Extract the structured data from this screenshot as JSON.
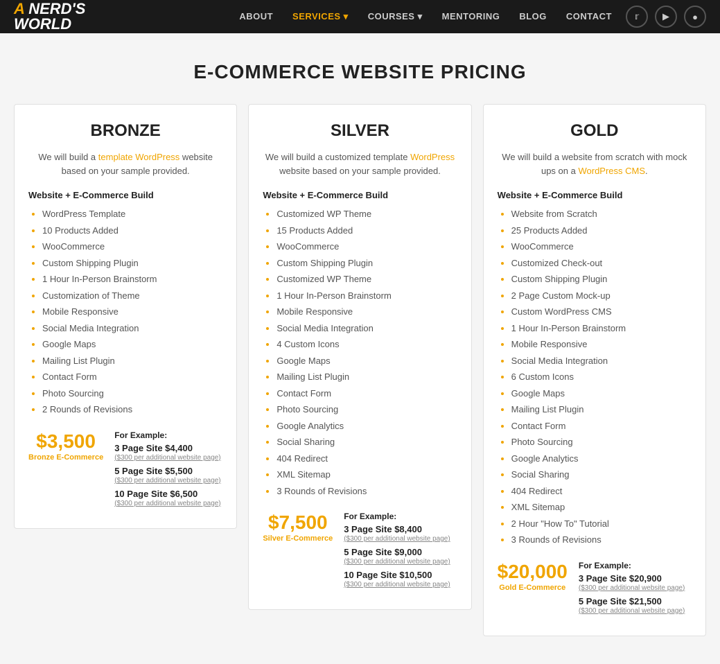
{
  "nav": {
    "logo_line1": "A NERD'S",
    "logo_line2": "WORLD",
    "links": [
      {
        "label": "ABOUT",
        "active": false
      },
      {
        "label": "SERVICES",
        "active": true,
        "has_dropdown": true
      },
      {
        "label": "COURSES",
        "active": false,
        "has_dropdown": true
      },
      {
        "label": "MENTORING",
        "active": false
      },
      {
        "label": "BLOG",
        "active": false
      },
      {
        "label": "CONTACT",
        "active": false
      }
    ],
    "social_icons": [
      "twitter",
      "youtube",
      "instagram"
    ]
  },
  "page": {
    "title": "E-COMMERCE WEBSITE PRICING"
  },
  "plans": [
    {
      "id": "bronze",
      "title": "BRONZE",
      "desc_parts": [
        "We will build a ",
        "template WordPress",
        " website based on your sample provided."
      ],
      "desc_link": "template WordPress",
      "section_header": "Website + E-Commerce Build",
      "features": [
        "WordPress Template",
        "10 Products Added",
        "WooCommerce",
        "Custom Shipping Plugin",
        "1 Hour In-Person Brainstorm",
        "Customization of Theme",
        "Mobile Responsive",
        "Social Media Integration",
        "Google Maps",
        "Mailing List Plugin",
        "Contact Form",
        "Photo Sourcing",
        "2 Rounds of Revisions"
      ],
      "price_amount": "$3,500",
      "price_label": "Bronze E-Commerce",
      "for_example": "For Example:",
      "price_rows": [
        {
          "label": "3 Page Site $4,400",
          "sub": "($300 per additional website page)"
        },
        {
          "label": "5 Page Site $5,500",
          "sub": "($300 per additional website page)"
        },
        {
          "label": "10 Page Site $6,500",
          "sub": "($300 per additional website page)"
        }
      ]
    },
    {
      "id": "silver",
      "title": "SILVER",
      "desc_parts": [
        "We will build a customized template ",
        "WordPress",
        " website based on your sample provided."
      ],
      "desc_link": "WordPress",
      "section_header": "Website + E-Commerce Build",
      "features": [
        "Customized WP Theme",
        "15 Products Added",
        "WooCommerce",
        "Custom Shipping Plugin",
        "Customized WP Theme",
        "1 Hour In-Person Brainstorm",
        "Mobile Responsive",
        "Social Media Integration",
        "4 Custom Icons",
        "Google Maps",
        "Mailing List Plugin",
        "Contact Form",
        "Photo Sourcing",
        "Google Analytics",
        "Social Sharing",
        "404 Redirect",
        "XML Sitemap",
        "3 Rounds of Revisions"
      ],
      "price_amount": "$7,500",
      "price_label": "Silver E-Commerce",
      "for_example": "For Example:",
      "price_rows": [
        {
          "label": "3 Page Site $8,400",
          "sub": "($300 per additional website page)"
        },
        {
          "label": "5 Page Site $9,000",
          "sub": "($300 per additional website page)"
        },
        {
          "label": "10 Page Site $10,500",
          "sub": "($300 per additional website page)"
        }
      ]
    },
    {
      "id": "gold",
      "title": "GOLD",
      "desc_parts": [
        "We will build a website from scratch with mock ups on a ",
        "WordPress CMS",
        "."
      ],
      "desc_link": "WordPress CMS",
      "section_header": "Website + E-Commerce Build",
      "features": [
        "Website from Scratch",
        "25 Products Added",
        "WooCommerce",
        "Customized Check-out",
        "Custom Shipping Plugin",
        "2 Page Custom Mock-up",
        "Custom WordPress CMS",
        "1 Hour In-Person Brainstorm",
        "Mobile Responsive",
        "Social Media Integration",
        "6 Custom Icons",
        "Google Maps",
        "Mailing List Plugin",
        "Contact Form",
        "Photo Sourcing",
        "Google Analytics",
        "Social Sharing",
        "404 Redirect",
        "XML Sitemap",
        "2 Hour \"How To\" Tutorial",
        "3 Rounds of Revisions"
      ],
      "price_amount": "$20,000",
      "price_label": "Gold E-Commerce",
      "for_example": "For Example:",
      "price_rows": [
        {
          "label": "3 Page Site $20,900",
          "sub": "($300 per additional website page)"
        },
        {
          "label": "5 Page Site $21,500",
          "sub": "($300 per additional website page)"
        }
      ]
    }
  ]
}
